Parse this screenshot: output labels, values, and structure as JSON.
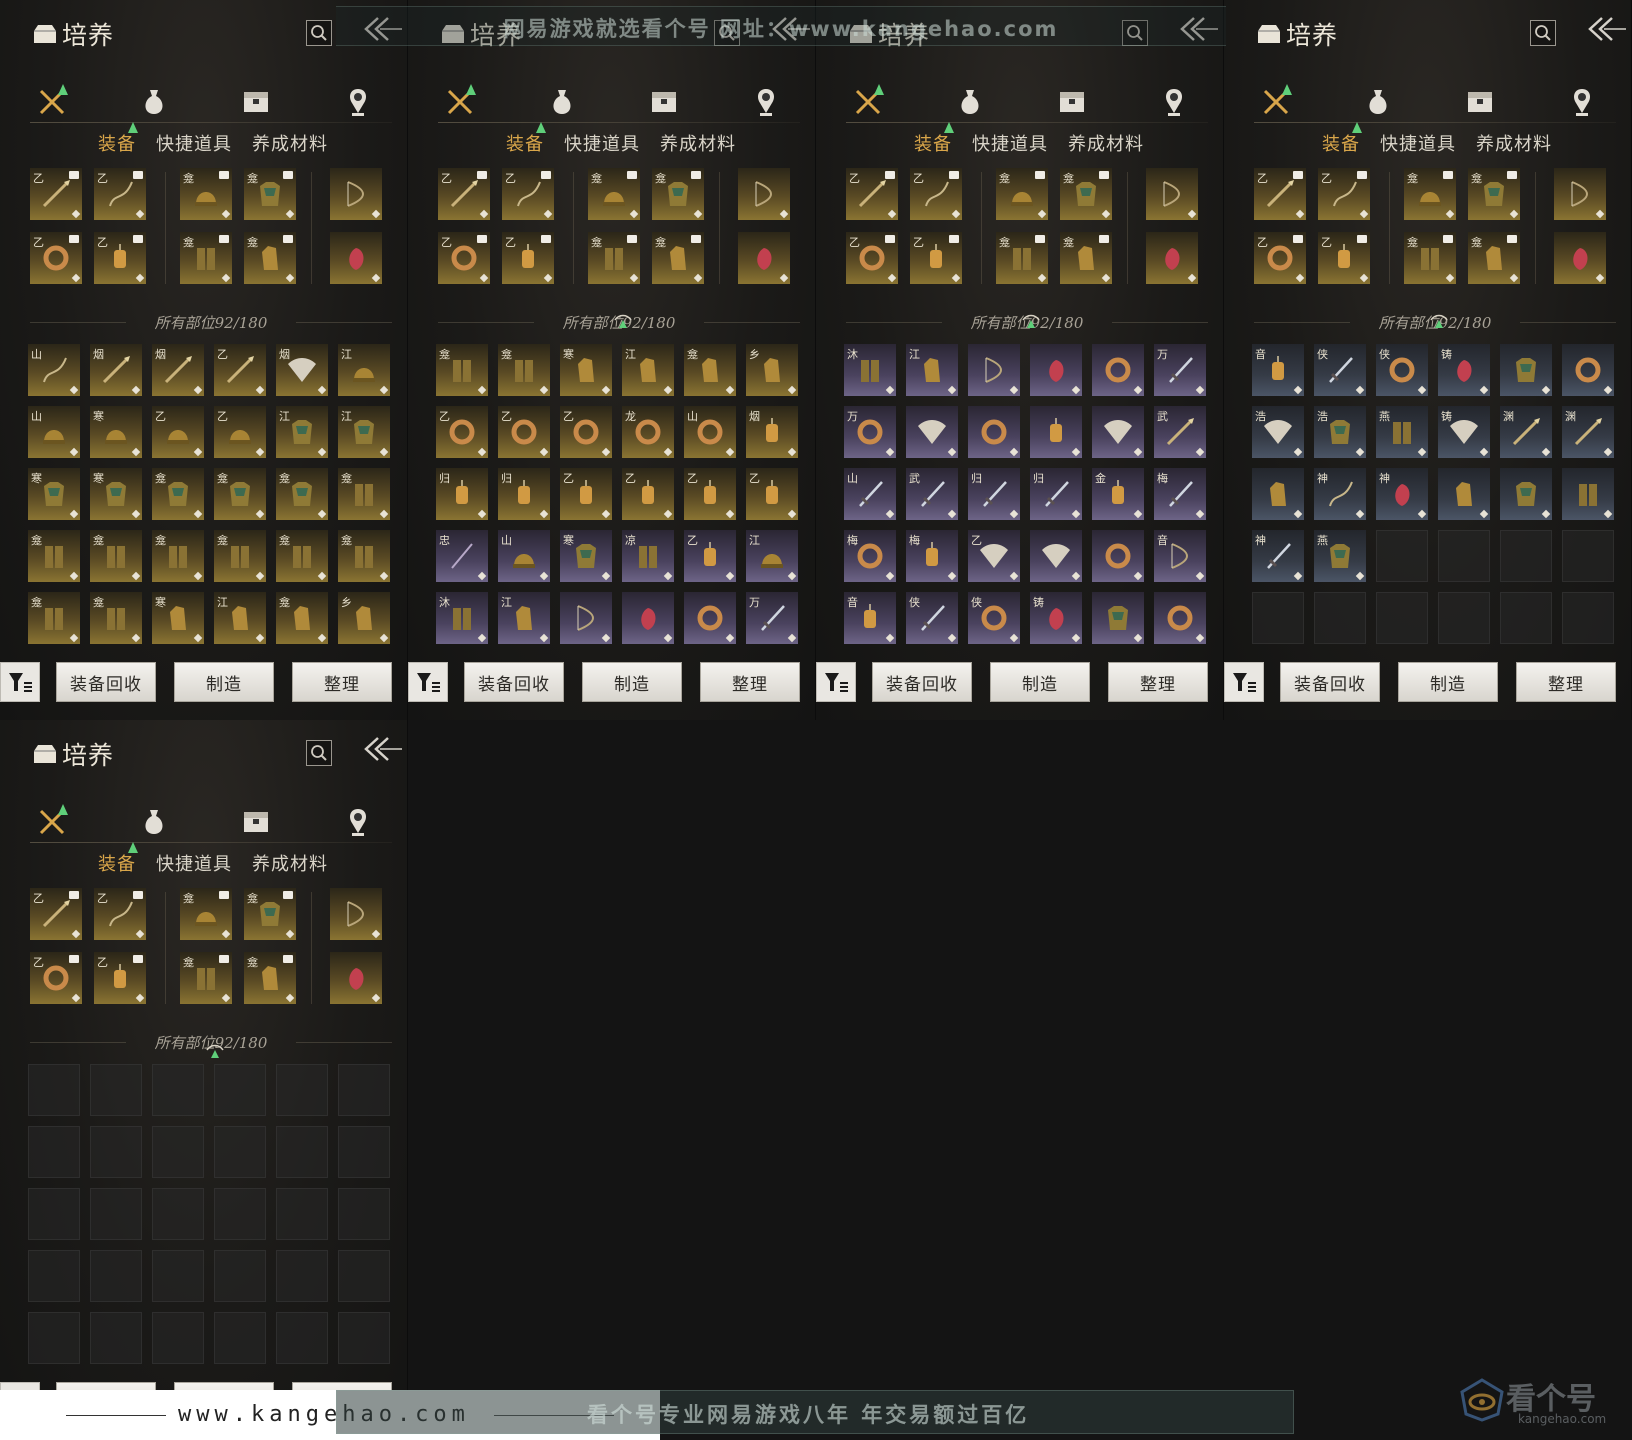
{
  "panel_title": "培养",
  "tabs": {
    "equipment": "装备",
    "quick_items": "快捷道具",
    "materials": "养成材料"
  },
  "tab_icons": [
    "crossed-swords-icon",
    "potion-pouch-icon",
    "chest-icon",
    "location-pin-icon"
  ],
  "slot_count": "所有部位92/180",
  "buttons": {
    "recycle": "装备回收",
    "craft": "制造",
    "sort": "整理"
  },
  "watermark_top": "网易游戏就选看个号   网址：www.kangehao.com",
  "footer": {
    "site": "www.kangehao.com",
    "slogan": "看个号专业网易游戏八年   年交易额过百亿"
  },
  "logo": {
    "name": "看个号",
    "sub": "kangehao.com"
  },
  "colors": {
    "accent_gold": "#d9a64a",
    "upgrade_green": "#5fcf7a",
    "background": "#141414"
  },
  "equip_slots": [
    {
      "glyph": "乙",
      "tier": "gold",
      "kind": "spear",
      "badge": true
    },
    {
      "glyph": "乙",
      "tier": "gold",
      "kind": "whip",
      "badge": true
    },
    {
      "glyph": "龛",
      "tier": "gold",
      "kind": "helmet",
      "badge": true
    },
    {
      "glyph": "龛",
      "tier": "gold",
      "kind": "armor",
      "badge": true
    },
    {
      "glyph": "",
      "tier": "gold",
      "kind": "bow",
      "badge": false
    },
    {
      "glyph": "乙",
      "tier": "gold",
      "kind": "ring",
      "badge": true
    },
    {
      "glyph": "乙",
      "tier": "gold",
      "kind": "pendant",
      "badge": true
    },
    {
      "glyph": "龛",
      "tier": "gold",
      "kind": "legs",
      "badge": true
    },
    {
      "glyph": "龛",
      "tier": "gold",
      "kind": "gauntlet",
      "badge": true
    },
    {
      "glyph": "",
      "tier": "gold",
      "kind": "jade",
      "badge": false
    }
  ],
  "pages": [
    {
      "items": [
        {
          "g": "山",
          "t": "gold",
          "k": "whip"
        },
        {
          "g": "烟",
          "t": "gold",
          "k": "spear"
        },
        {
          "g": "烟",
          "t": "gold",
          "k": "spear"
        },
        {
          "g": "乙",
          "t": "gold",
          "k": "spear"
        },
        {
          "g": "烟",
          "t": "gold",
          "k": "fan"
        },
        {
          "g": "江",
          "t": "gold",
          "k": "helmet"
        },
        {
          "g": "山",
          "t": "gold",
          "k": "helmet"
        },
        {
          "g": "寒",
          "t": "gold",
          "k": "helmet"
        },
        {
          "g": "乙",
          "t": "gold",
          "k": "helmet"
        },
        {
          "g": "乙",
          "t": "gold",
          "k": "helmet"
        },
        {
          "g": "江",
          "t": "gold",
          "k": "armor"
        },
        {
          "g": "江",
          "t": "gold",
          "k": "armor"
        },
        {
          "g": "寒",
          "t": "gold",
          "k": "armor"
        },
        {
          "g": "寒",
          "t": "gold",
          "k": "armor"
        },
        {
          "g": "龛",
          "t": "gold",
          "k": "armor"
        },
        {
          "g": "龛",
          "t": "gold",
          "k": "armor"
        },
        {
          "g": "龛",
          "t": "gold",
          "k": "armor"
        },
        {
          "g": "龛",
          "t": "gold",
          "k": "legs"
        },
        {
          "g": "龛",
          "t": "gold",
          "k": "legs"
        },
        {
          "g": "龛",
          "t": "gold",
          "k": "legs"
        },
        {
          "g": "龛",
          "t": "gold",
          "k": "legs"
        },
        {
          "g": "龛",
          "t": "gold",
          "k": "legs"
        },
        {
          "g": "龛",
          "t": "gold",
          "k": "legs"
        },
        {
          "g": "龛",
          "t": "gold",
          "k": "legs"
        },
        {
          "g": "龛",
          "t": "gold",
          "k": "legs"
        },
        {
          "g": "龛",
          "t": "gold",
          "k": "legs"
        },
        {
          "g": "寒",
          "t": "gold",
          "k": "gauntlet"
        },
        {
          "g": "江",
          "t": "gold",
          "k": "gauntlet"
        },
        {
          "g": "龛",
          "t": "gold",
          "k": "gauntlet"
        },
        {
          "g": "乡",
          "t": "gold",
          "k": "gauntlet"
        }
      ]
    },
    {
      "items": [
        {
          "g": "龛",
          "t": "gold",
          "k": "legs"
        },
        {
          "g": "龛",
          "t": "gold",
          "k": "legs"
        },
        {
          "g": "寒",
          "t": "gold",
          "k": "gauntlet"
        },
        {
          "g": "江",
          "t": "gold",
          "k": "gauntlet"
        },
        {
          "g": "龛",
          "t": "gold",
          "k": "gauntlet"
        },
        {
          "g": "乡",
          "t": "gold",
          "k": "gauntlet"
        },
        {
          "g": "乙",
          "t": "gold",
          "k": "ring"
        },
        {
          "g": "乙",
          "t": "gold",
          "k": "ring"
        },
        {
          "g": "乙",
          "t": "gold",
          "k": "ring"
        },
        {
          "g": "龙",
          "t": "gold",
          "k": "ring"
        },
        {
          "g": "山",
          "t": "gold",
          "k": "ring"
        },
        {
          "g": "烟",
          "t": "gold",
          "k": "pendant"
        },
        {
          "g": "归",
          "t": "gold",
          "k": "pendant"
        },
        {
          "g": "归",
          "t": "gold",
          "k": "pendant"
        },
        {
          "g": "乙",
          "t": "gold",
          "k": "pendant"
        },
        {
          "g": "乙",
          "t": "gold",
          "k": "pendant"
        },
        {
          "g": "乙",
          "t": "gold",
          "k": "pendant"
        },
        {
          "g": "乙",
          "t": "gold",
          "k": "pendant"
        },
        {
          "g": "忠",
          "t": "purple",
          "k": "staff"
        },
        {
          "g": "山",
          "t": "purple",
          "k": "helmet"
        },
        {
          "g": "寒",
          "t": "purple",
          "k": "armor"
        },
        {
          "g": "凉",
          "t": "purple",
          "k": "legs"
        },
        {
          "g": "乙",
          "t": "purple",
          "k": "pendant"
        },
        {
          "g": "江",
          "t": "purple",
          "k": "helmet"
        },
        {
          "g": "沐",
          "t": "purple",
          "k": "legs"
        },
        {
          "g": "江",
          "t": "purple",
          "k": "gauntlet"
        },
        {
          "g": "",
          "t": "purple",
          "k": "bow"
        },
        {
          "g": "",
          "t": "purple",
          "k": "jade"
        },
        {
          "g": "",
          "t": "purple",
          "k": "ring"
        },
        {
          "g": "万",
          "t": "purple",
          "k": "sword"
        }
      ]
    },
    {
      "items": [
        {
          "g": "沐",
          "t": "purple",
          "k": "legs"
        },
        {
          "g": "江",
          "t": "purple",
          "k": "gauntlet"
        },
        {
          "g": "",
          "t": "purple",
          "k": "bow"
        },
        {
          "g": "",
          "t": "purple",
          "k": "jade"
        },
        {
          "g": "",
          "t": "purple",
          "k": "ring"
        },
        {
          "g": "万",
          "t": "purple",
          "k": "sword"
        },
        {
          "g": "万",
          "t": "purple",
          "k": "ring"
        },
        {
          "g": "",
          "t": "purple",
          "k": "fan"
        },
        {
          "g": "",
          "t": "purple",
          "k": "ring"
        },
        {
          "g": "",
          "t": "purple",
          "k": "pendant"
        },
        {
          "g": "",
          "t": "purple",
          "k": "fan"
        },
        {
          "g": "武",
          "t": "purple",
          "k": "spear"
        },
        {
          "g": "山",
          "t": "purple",
          "k": "sword"
        },
        {
          "g": "武",
          "t": "purple",
          "k": "sword"
        },
        {
          "g": "归",
          "t": "purple",
          "k": "sword"
        },
        {
          "g": "归",
          "t": "purple",
          "k": "sword"
        },
        {
          "g": "金",
          "t": "purple",
          "k": "pendant"
        },
        {
          "g": "梅",
          "t": "purple",
          "k": "sword"
        },
        {
          "g": "梅",
          "t": "purple",
          "k": "ring"
        },
        {
          "g": "梅",
          "t": "purple",
          "k": "pendant"
        },
        {
          "g": "乙",
          "t": "purple",
          "k": "fan"
        },
        {
          "g": "",
          "t": "purple",
          "k": "fan"
        },
        {
          "g": "",
          "t": "purple",
          "k": "ring"
        },
        {
          "g": "音",
          "t": "purple",
          "k": "bow"
        },
        {
          "g": "音",
          "t": "purple",
          "k": "pendant"
        },
        {
          "g": "侠",
          "t": "purple",
          "k": "sword"
        },
        {
          "g": "侠",
          "t": "purple",
          "k": "ring"
        },
        {
          "g": "铸",
          "t": "purple",
          "k": "jade"
        },
        {
          "g": "",
          "t": "purple",
          "k": "armor"
        },
        {
          "g": "",
          "t": "purple",
          "k": "ring"
        }
      ]
    },
    {
      "items": [
        {
          "g": "音",
          "t": "blue",
          "k": "pendant"
        },
        {
          "g": "侠",
          "t": "blue",
          "k": "sword"
        },
        {
          "g": "侠",
          "t": "blue",
          "k": "ring"
        },
        {
          "g": "铸",
          "t": "blue",
          "k": "jade"
        },
        {
          "g": "",
          "t": "blue",
          "k": "armor"
        },
        {
          "g": "",
          "t": "blue",
          "k": "ring"
        },
        {
          "g": "浩",
          "t": "blue",
          "k": "fan"
        },
        {
          "g": "浩",
          "t": "blue",
          "k": "armor"
        },
        {
          "g": "燕",
          "t": "blue",
          "k": "legs"
        },
        {
          "g": "铸",
          "t": "blue",
          "k": "fan"
        },
        {
          "g": "渊",
          "t": "blue",
          "k": "spear"
        },
        {
          "g": "渊",
          "t": "blue",
          "k": "spear"
        },
        {
          "g": "",
          "t": "blue",
          "k": "gauntlet"
        },
        {
          "g": "神",
          "t": "blue",
          "k": "whip"
        },
        {
          "g": "神",
          "t": "blue",
          "k": "jade"
        },
        {
          "g": "",
          "t": "blue",
          "k": "gauntlet"
        },
        {
          "g": "",
          "t": "blue",
          "k": "armor"
        },
        {
          "g": "",
          "t": "blue",
          "k": "legs"
        },
        {
          "g": "神",
          "t": "blue",
          "k": "sword"
        },
        {
          "g": "燕",
          "t": "blue",
          "k": "armor"
        },
        {
          "g": "",
          "t": "empty",
          "k": ""
        },
        {
          "g": "",
          "t": "empty",
          "k": ""
        },
        {
          "g": "",
          "t": "empty",
          "k": ""
        },
        {
          "g": "",
          "t": "empty",
          "k": ""
        },
        {
          "g": "",
          "t": "empty",
          "k": ""
        },
        {
          "g": "",
          "t": "empty",
          "k": ""
        },
        {
          "g": "",
          "t": "empty",
          "k": ""
        },
        {
          "g": "",
          "t": "empty",
          "k": ""
        },
        {
          "g": "",
          "t": "empty",
          "k": ""
        },
        {
          "g": "",
          "t": "empty",
          "k": ""
        }
      ]
    },
    {
      "items": [
        {
          "g": "",
          "t": "empty",
          "k": ""
        },
        {
          "g": "",
          "t": "empty",
          "k": ""
        },
        {
          "g": "",
          "t": "empty",
          "k": ""
        },
        {
          "g": "",
          "t": "empty",
          "k": ""
        },
        {
          "g": "",
          "t": "empty",
          "k": ""
        },
        {
          "g": "",
          "t": "empty",
          "k": ""
        },
        {
          "g": "",
          "t": "empty",
          "k": ""
        },
        {
          "g": "",
          "t": "empty",
          "k": ""
        },
        {
          "g": "",
          "t": "empty",
          "k": ""
        },
        {
          "g": "",
          "t": "empty",
          "k": ""
        },
        {
          "g": "",
          "t": "empty",
          "k": ""
        },
        {
          "g": "",
          "t": "empty",
          "k": ""
        },
        {
          "g": "",
          "t": "empty",
          "k": ""
        },
        {
          "g": "",
          "t": "empty",
          "k": ""
        },
        {
          "g": "",
          "t": "empty",
          "k": ""
        },
        {
          "g": "",
          "t": "empty",
          "k": ""
        },
        {
          "g": "",
          "t": "empty",
          "k": ""
        },
        {
          "g": "",
          "t": "empty",
          "k": ""
        },
        {
          "g": "",
          "t": "empty",
          "k": ""
        },
        {
          "g": "",
          "t": "empty",
          "k": ""
        },
        {
          "g": "",
          "t": "empty",
          "k": ""
        },
        {
          "g": "",
          "t": "empty",
          "k": ""
        },
        {
          "g": "",
          "t": "empty",
          "k": ""
        },
        {
          "g": "",
          "t": "empty",
          "k": ""
        },
        {
          "g": "",
          "t": "empty",
          "k": ""
        },
        {
          "g": "",
          "t": "empty",
          "k": ""
        },
        {
          "g": "",
          "t": "empty",
          "k": ""
        },
        {
          "g": "",
          "t": "empty",
          "k": ""
        },
        {
          "g": "",
          "t": "empty",
          "k": ""
        },
        {
          "g": "",
          "t": "empty",
          "k": ""
        }
      ]
    }
  ]
}
